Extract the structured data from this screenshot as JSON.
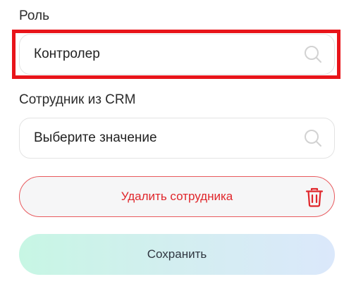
{
  "role": {
    "label": "Роль",
    "value": "Контролер"
  },
  "employee": {
    "label": "Сотрудник из CRM",
    "placeholder": "Выберите значение"
  },
  "actions": {
    "delete_label": "Удалить сотрудника",
    "save_label": "Сохранить"
  },
  "colors": {
    "highlight": "#e8141a",
    "danger": "#e0262b",
    "save_gradient_start": "#c7f6e4",
    "save_gradient_end": "#dbe8fb"
  },
  "icons": {
    "search": "search-icon",
    "trash": "trash-icon"
  }
}
